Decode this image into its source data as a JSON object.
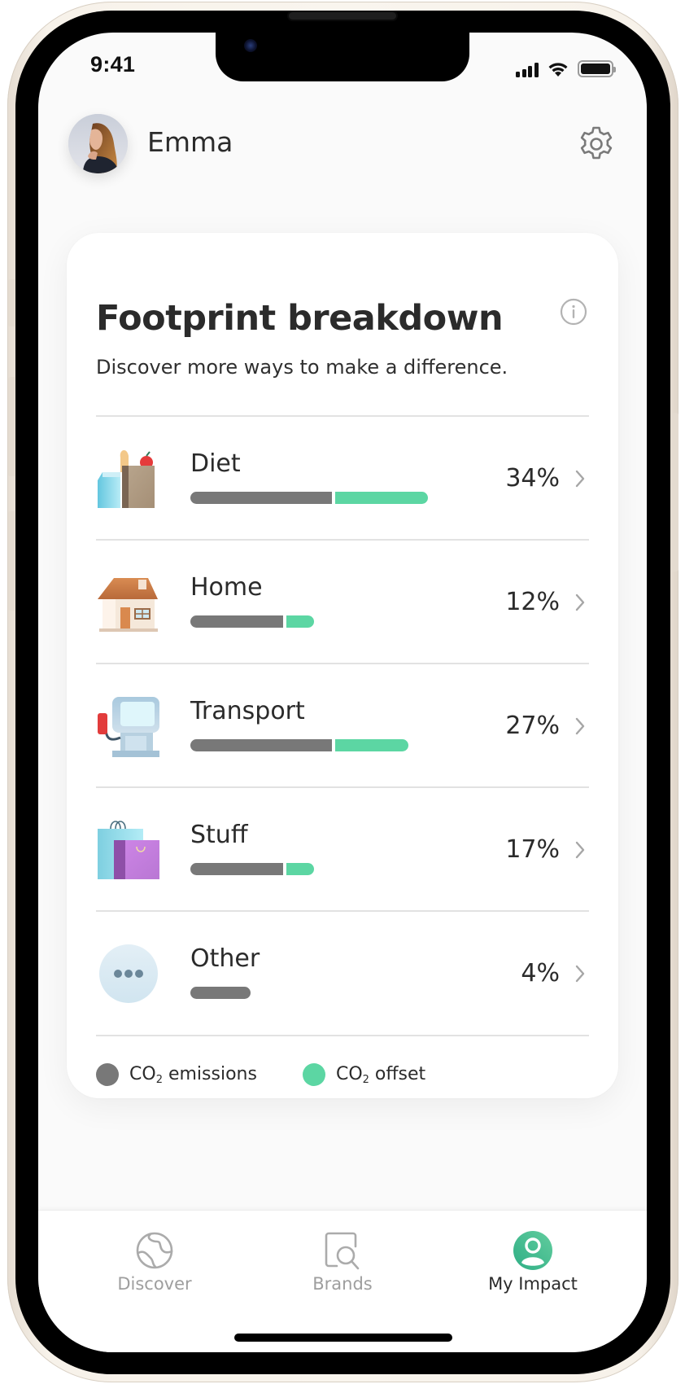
{
  "status_bar": {
    "time": "9:41",
    "icons": [
      "cellular-signal-icon",
      "wifi-icon",
      "battery-icon"
    ]
  },
  "header": {
    "user_name": "Emma",
    "avatar": "user-avatar-photo",
    "settings_icon": "gear-icon"
  },
  "card": {
    "title": "Footprint breakdown",
    "subtitle": "Discover more ways to make a difference.",
    "info_icon": "info-icon",
    "categories": [
      {
        "label": "Diet",
        "percent": "34%",
        "icon": "groceries-icon",
        "emissions": 0.58,
        "offset": 0.38
      },
      {
        "label": "Home",
        "percent": "12%",
        "icon": "house-icon",
        "emissions": 0.38,
        "offset": 0.113
      },
      {
        "label": "Transport",
        "percent": "27%",
        "icon": "fuel-pump-icon",
        "emissions": 0.58,
        "offset": 0.3
      },
      {
        "label": "Stuff",
        "percent": "17%",
        "icon": "shopping-bags-icon",
        "emissions": 0.38,
        "offset": 0.113
      },
      {
        "label": "Other",
        "percent": "4%",
        "icon": "more-dots-icon",
        "emissions": 0.247,
        "offset": 0
      }
    ],
    "legend": {
      "emissions": {
        "prefix": "CO",
        "sub": "2",
        "suffix": " emissions",
        "color": "#787878"
      },
      "offset": {
        "prefix": "CO",
        "sub": "2",
        "suffix": " offset",
        "color": "#5cd6a3"
      }
    }
  },
  "tabbar": {
    "tabs": [
      {
        "label": "Discover",
        "icon": "globe-icon",
        "active": false
      },
      {
        "label": "Brands",
        "icon": "brand-search-icon",
        "active": false
      },
      {
        "label": "My Impact",
        "icon": "profile-icon",
        "active": true
      }
    ]
  },
  "colors": {
    "accent": "#3dbd8f",
    "emissions": "#787878",
    "offset": "#5cd6a3",
    "text": "#2b2b2b",
    "inactive": "#9e9e9e"
  }
}
